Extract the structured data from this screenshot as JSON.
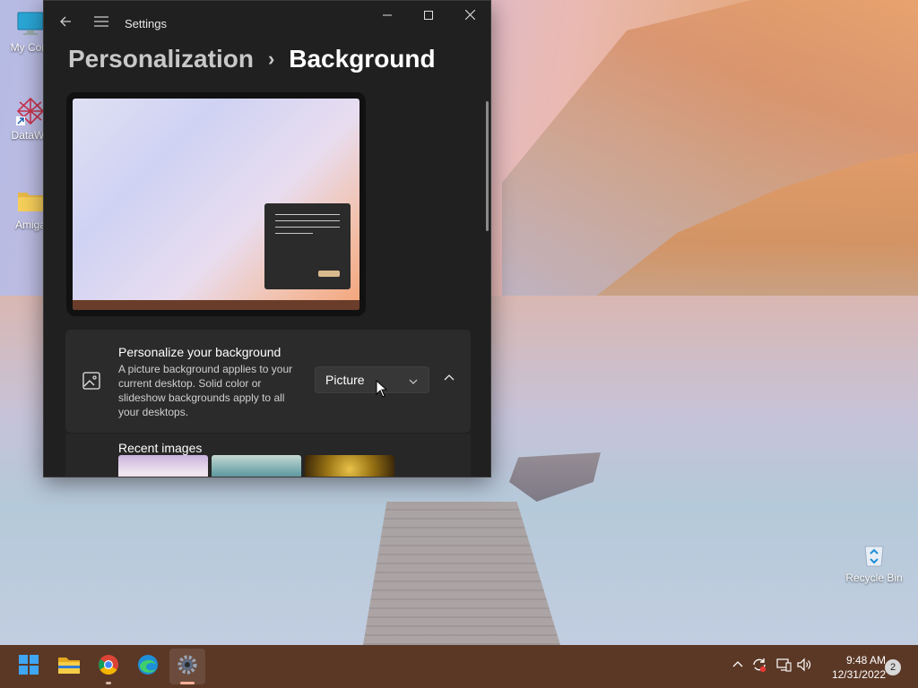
{
  "desktop": {
    "icons": [
      {
        "label": "My Com"
      },
      {
        "label": "DataWa"
      },
      {
        "label": "Amiga"
      },
      {
        "label": "Recycle Bin"
      }
    ]
  },
  "window": {
    "title": "Settings",
    "breadcrumb": {
      "parent": "Personalization",
      "separator": "›",
      "current": "Background"
    }
  },
  "background_card": {
    "title": "Personalize your background",
    "description": "A picture background applies to your current desktop. Solid color or slideshow backgrounds apply to all your desktops.",
    "dropdown_value": "Picture"
  },
  "recent_images": {
    "title": "Recent images"
  },
  "taskbar": {
    "apps": [
      "start-icon",
      "file-explorer-icon",
      "chrome-icon",
      "edge-icon",
      "settings-icon"
    ]
  },
  "tray": {
    "time": "9:48 AM",
    "date": "12/31/2022",
    "notification_count": "2"
  },
  "colors": {
    "window_bg": "#202020",
    "card_bg": "#2b2b2b",
    "taskbar_bg": "#5b3826"
  }
}
